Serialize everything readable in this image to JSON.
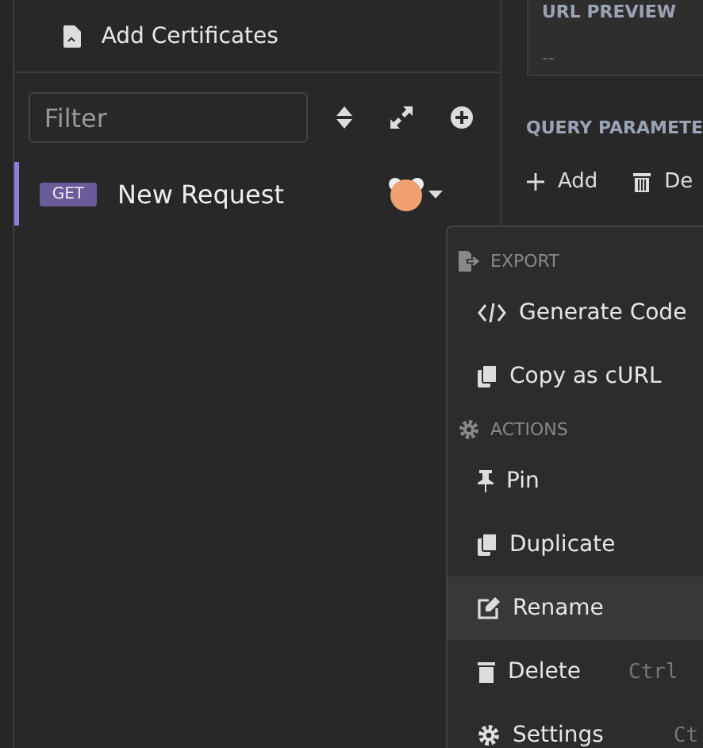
{
  "sidebar": {
    "add_certificates": "Add Certificates",
    "filter": {
      "placeholder": "Filter"
    },
    "requests": [
      {
        "method": "GET",
        "name": "New Request",
        "selected": true
      }
    ]
  },
  "main": {
    "url_preview": {
      "label": "URL PREVIEW",
      "value": "--"
    },
    "query_parameters": {
      "title": "QUERY PARAMETE",
      "actions": [
        "Add",
        "De"
      ]
    }
  },
  "context_menu": {
    "items": [
      {
        "kind": "header",
        "label": "EXPORT"
      },
      {
        "kind": "item",
        "label": "Generate Code",
        "selected": false
      },
      {
        "kind": "item",
        "label": "Copy as cURL",
        "selected": false
      },
      {
        "kind": "header",
        "label": "ACTIONS"
      },
      {
        "kind": "item",
        "label": "Pin",
        "selected": false
      },
      {
        "kind": "item",
        "label": "Duplicate",
        "selected": false
      },
      {
        "kind": "item",
        "label": "Rename",
        "selected": true
      },
      {
        "kind": "item",
        "label": "Delete",
        "shortcut": "Ctrl",
        "selected": false
      },
      {
        "kind": "item",
        "label": "Settings",
        "shortcut": "Ct",
        "selected": false
      }
    ]
  }
}
